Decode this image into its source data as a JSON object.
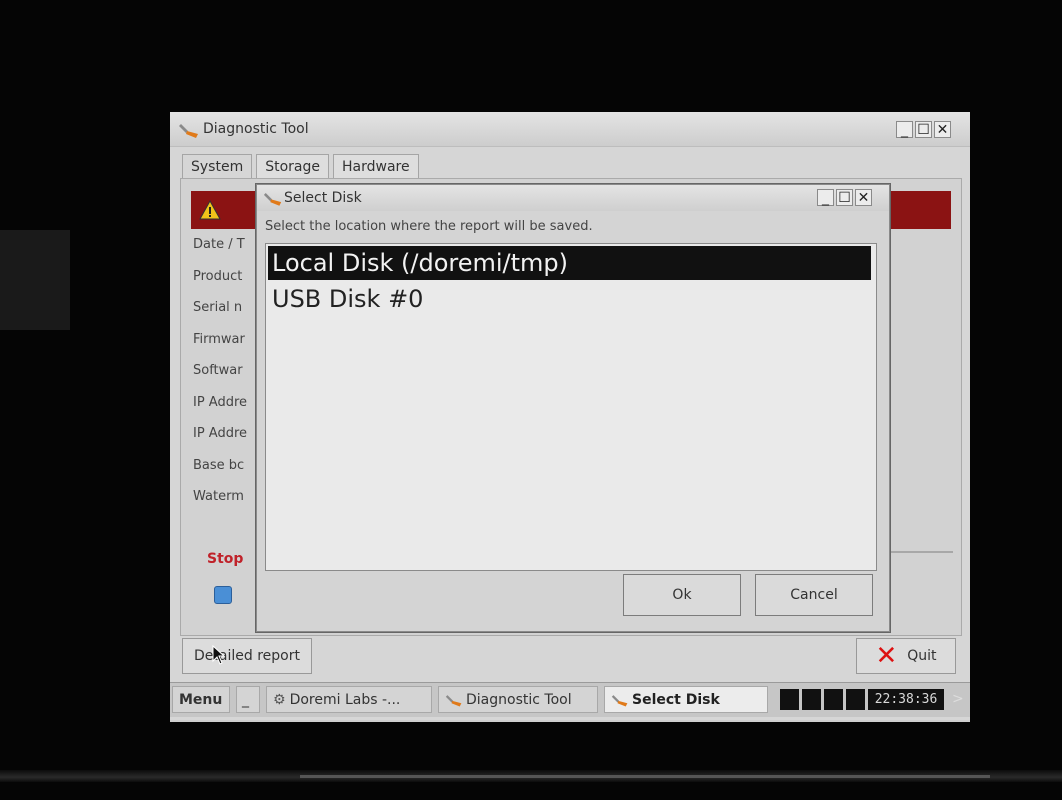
{
  "main_window": {
    "title": "Diagnostic Tool",
    "controls": {
      "minimize": "_",
      "maximize": "☐",
      "close": "✕"
    },
    "tabs": [
      {
        "label": "System",
        "active": true
      },
      {
        "label": "Storage",
        "active": false
      },
      {
        "label": "Hardware",
        "active": false
      }
    ],
    "field_labels": [
      "Date / T",
      "Product",
      "Serial n",
      "Firmwar",
      "Softwar",
      "IP Addre",
      "IP Addre",
      "Base bc",
      "Waterm"
    ],
    "stop_label": "Stop",
    "detailed_report_button": "Detailed report",
    "quit_button": "Quit"
  },
  "dialog": {
    "title": "Select Disk",
    "controls": {
      "minimize": "_",
      "maximize": "☐",
      "close": "✕"
    },
    "instruction": "Select the location where the report will be saved.",
    "disks": [
      {
        "label": "Local Disk (/doremi/tmp)",
        "selected": true
      },
      {
        "label": "USB Disk #0",
        "selected": false
      }
    ],
    "ok_button": "Ok",
    "cancel_button": "Cancel"
  },
  "taskbar": {
    "menu": "Menu",
    "minimize": "_",
    "tasks": [
      {
        "label": "Doremi Labs -...",
        "active": false
      },
      {
        "label": "Diagnostic Tool",
        "active": false
      },
      {
        "label": "Select Disk",
        "active": true
      }
    ],
    "clock": "22:38:36",
    "arrow": ">"
  },
  "colors": {
    "alert_bar": "#8b1313",
    "stop_text": "#c0222a",
    "selection": "#111111",
    "quit_x": "#dd1111"
  }
}
